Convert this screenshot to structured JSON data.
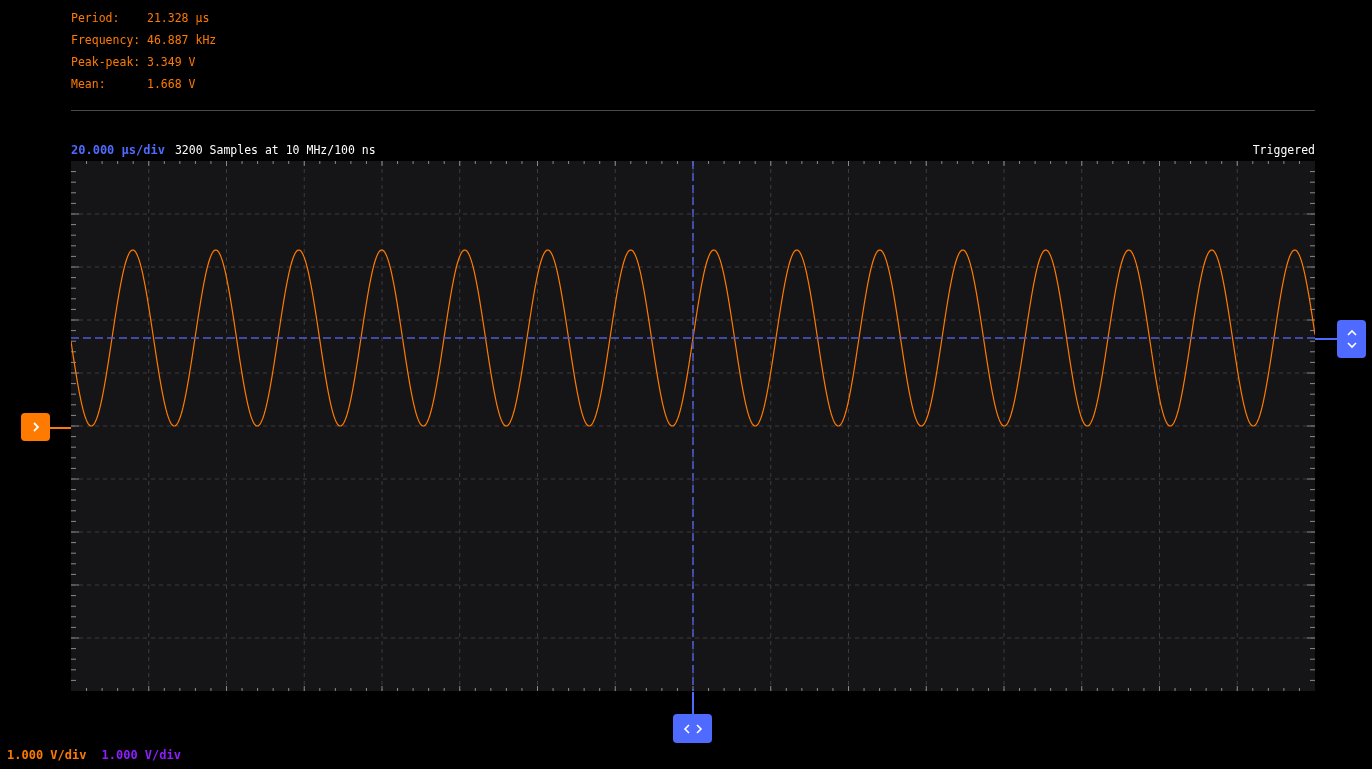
{
  "measurements": [
    {
      "label": "Period:",
      "value": "21.328 µs"
    },
    {
      "label": "Frequency:",
      "value": "46.887 kHz"
    },
    {
      "label": "Peak-peak:",
      "value": "3.349 V"
    },
    {
      "label": "Mean:",
      "value": "1.668 V"
    }
  ],
  "header": {
    "timebase": "20.000 µs/div",
    "samples": "3200 Samples at 10 MHz/100 ns",
    "status": "Triggered"
  },
  "channels": [
    {
      "scale": "1.000 V/div",
      "color": "#ff7a00"
    },
    {
      "scale": "1.000 V/div",
      "color": "#8f1eff"
    }
  ]
}
